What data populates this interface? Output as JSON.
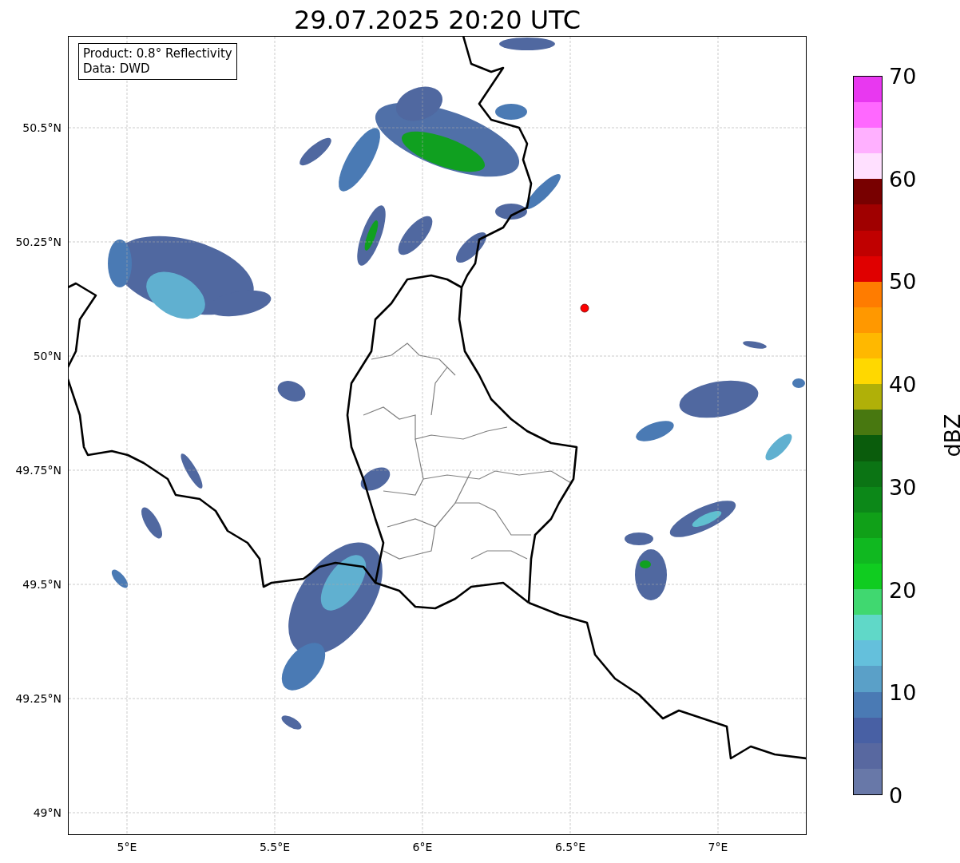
{
  "title": "29.07.2025 20:20 UTC",
  "legend": [
    "Product: 0.8° Reflectivity",
    "Data: DWD"
  ],
  "x_axis": {
    "ticks": [
      "5°E",
      "5.5°E",
      "6°E",
      "6.5°E",
      "7°E"
    ]
  },
  "y_axis": {
    "ticks": [
      "50.5°N",
      "50.25°N",
      "50°N",
      "49.75°N",
      "49.5°N",
      "49.25°N",
      "49°N"
    ]
  },
  "colorbar": {
    "label": "dBZ",
    "ticks": [
      "70",
      "60",
      "50",
      "40",
      "30",
      "20",
      "10",
      "0"
    ],
    "bands": [
      {
        "color": "#6878a8"
      },
      {
        "color": "#5868a0"
      },
      {
        "color": "#4860a4"
      },
      {
        "color": "#4a7ab4"
      },
      {
        "color": "#5aa0c8"
      },
      {
        "color": "#64c0dc"
      },
      {
        "color": "#60d8c8"
      },
      {
        "color": "#40d870"
      },
      {
        "color": "#10cc20"
      },
      {
        "color": "#10b820"
      },
      {
        "color": "#10a018"
      },
      {
        "color": "#0c8818"
      },
      {
        "color": "#0b7414"
      },
      {
        "color": "#0a5c0c"
      },
      {
        "color": "#487810"
      },
      {
        "color": "#b0b008"
      },
      {
        "color": "#ffd800"
      },
      {
        "color": "#ffb800"
      },
      {
        "color": "#ff9800"
      },
      {
        "color": "#ff7c00"
      },
      {
        "color": "#e00000"
      },
      {
        "color": "#c00000"
      },
      {
        "color": "#a00000"
      },
      {
        "color": "#780000"
      },
      {
        "color": "#ffe0ff"
      },
      {
        "color": "#ffb0ff"
      },
      {
        "color": "#ff68ff"
      },
      {
        "color": "#e838f0"
      }
    ]
  }
}
